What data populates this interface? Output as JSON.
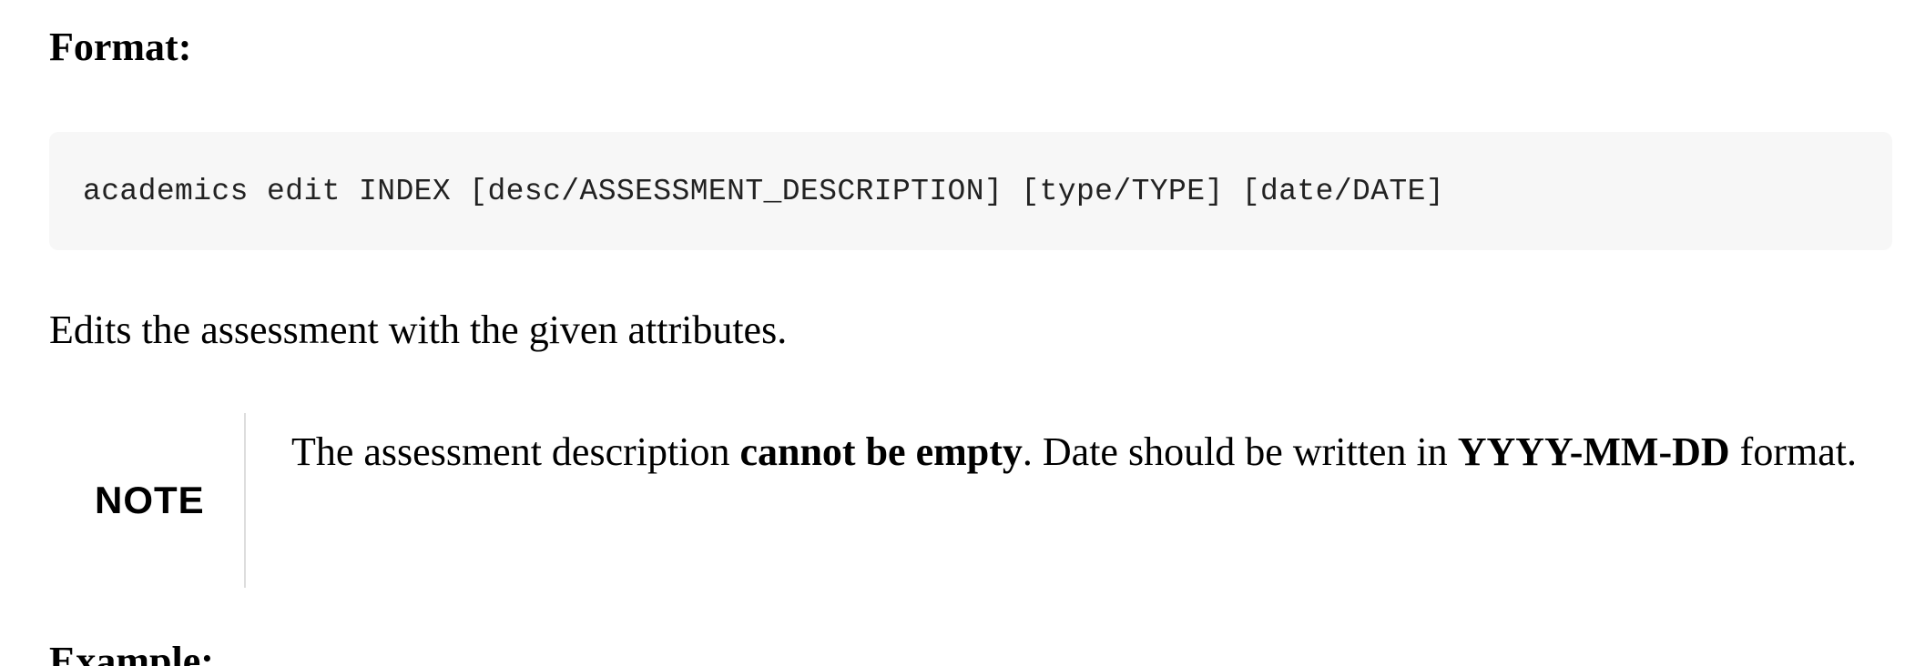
{
  "format_heading": "Format:",
  "code": "academics edit INDEX [desc/ASSESSMENT_DESCRIPTION] [type/TYPE] [date/DATE]",
  "description": "Edits the assessment with the given attributes.",
  "note": {
    "label": "NOTE",
    "text_1": "The assessment description ",
    "bold_1": "cannot be empty",
    "text_2": ". Date should be written in ",
    "bold_2": "YYYY-MM-DD",
    "text_3": " format."
  },
  "example_heading": "Example:"
}
